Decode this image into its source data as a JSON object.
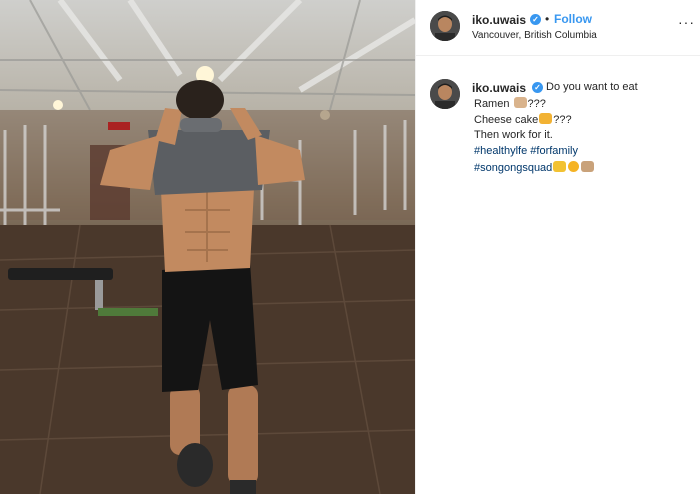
{
  "post": {
    "username": "iko.uwais",
    "verified_mark": "✓",
    "separator": "•",
    "follow_label": "Follow",
    "location": "Vancouver, British Columbia",
    "more_label": "···"
  },
  "caption": {
    "username": "iko.uwais",
    "line1": "Do you want to eat",
    "line2": "Ramen",
    "line2_suffix": "???",
    "line3": "Cheese cake",
    "line3_suffix": "???",
    "line4": "Then work for it.",
    "hashtags": {
      "healthylife": "#healthylfe",
      "forfamily": "#forfamily",
      "songongsquad": "#songongsquad"
    }
  },
  "icons": {
    "verified": "verified-badge-icon",
    "more": "more-options-icon",
    "ramen": "ramen-emoji-icon",
    "cake": "cake-emoji-icon",
    "muscle": "flexed-bicep-emoji-icon",
    "smile": "smiling-emoji-icon",
    "fist": "fist-emoji-icon"
  },
  "colors": {
    "link_blue": "#3897f0",
    "hashtag": "#00376b",
    "text": "#262626",
    "divider": "#efefef"
  }
}
